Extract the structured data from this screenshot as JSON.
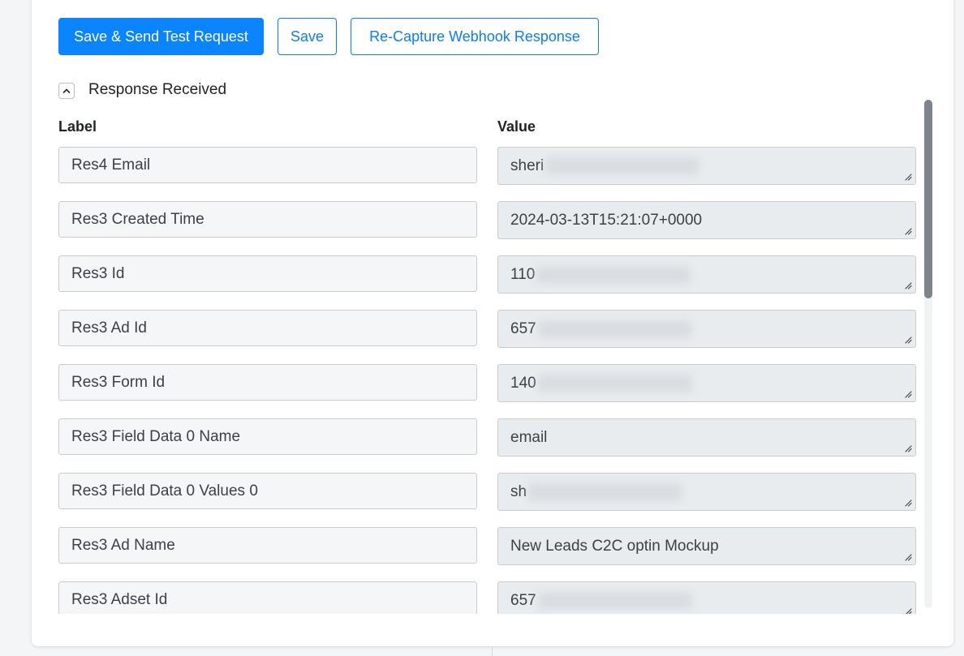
{
  "actions": {
    "send_label": "Save & Send Test Request",
    "save_label": "Save",
    "recapture_label": "Re-Capture Webhook Response"
  },
  "section": {
    "title": "Response Received",
    "toggle_icon": "chevron-up-icon"
  },
  "columns": {
    "label": "Label",
    "value": "Value"
  },
  "rows": [
    {
      "label": "Res4 Email",
      "value": "sheri",
      "redacted": true
    },
    {
      "label": "Res3 Created Time",
      "value": "2024-03-13T15:21:07+0000",
      "redacted": false
    },
    {
      "label": "Res3 Id",
      "value": "110",
      "redacted": true
    },
    {
      "label": "Res3 Ad Id",
      "value": "657",
      "redacted": true
    },
    {
      "label": "Res3 Form Id",
      "value": "140",
      "redacted": true
    },
    {
      "label": "Res3 Field Data 0 Name",
      "value": "email",
      "redacted": false
    },
    {
      "label": "Res3 Field Data 0 Values 0",
      "value": "sh",
      "redacted": true
    },
    {
      "label": "Res3 Ad Name",
      "value": "New Leads C2C optin Mockup",
      "redacted": false
    },
    {
      "label": "Res3 Adset Id",
      "value": "657",
      "redacted": true
    }
  ],
  "colors": {
    "primary": "#0a84ff",
    "outline": "#0a7cff",
    "scroll_thumb": "#7d848c"
  }
}
